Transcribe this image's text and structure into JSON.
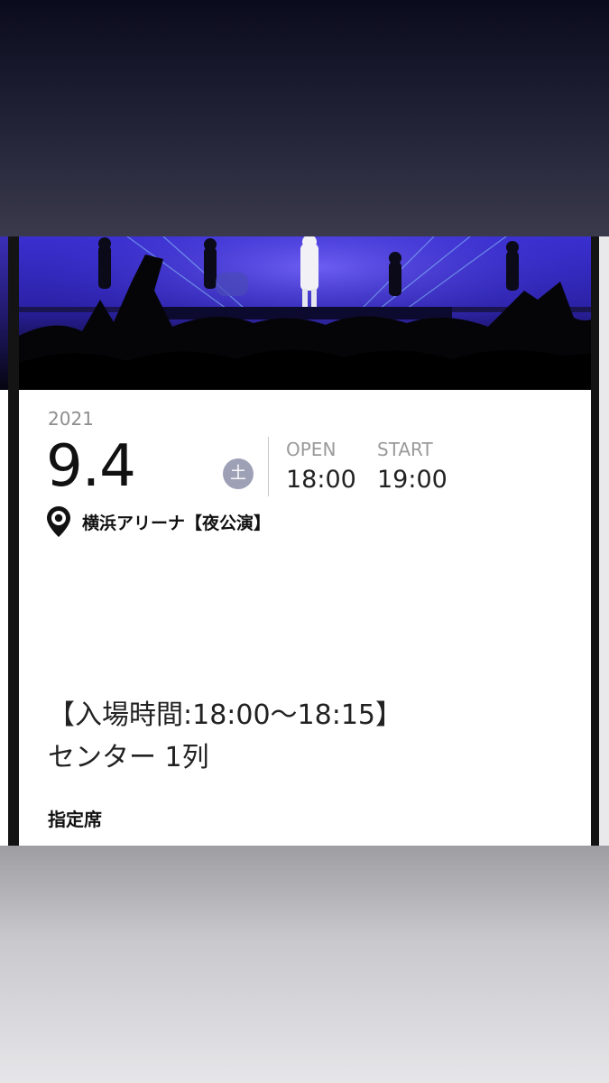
{
  "ticket": {
    "year": "2021",
    "date": "9.4",
    "weekday": "土",
    "open_label": "OPEN",
    "open_time": "18:00",
    "start_label": "START",
    "start_time": "19:00",
    "venue": "横浜アリーナ【夜公演】",
    "entry_time": "【入場時間:18:00〜18:15】",
    "seat": "センター 1列",
    "seat_type": "指定席"
  },
  "icons": {
    "venue": "location-pin-icon"
  },
  "colors": {
    "weekday_badge": "#9ea0b6",
    "label_gray": "#9a9a9a",
    "stage_light": "#3b2fd6"
  }
}
